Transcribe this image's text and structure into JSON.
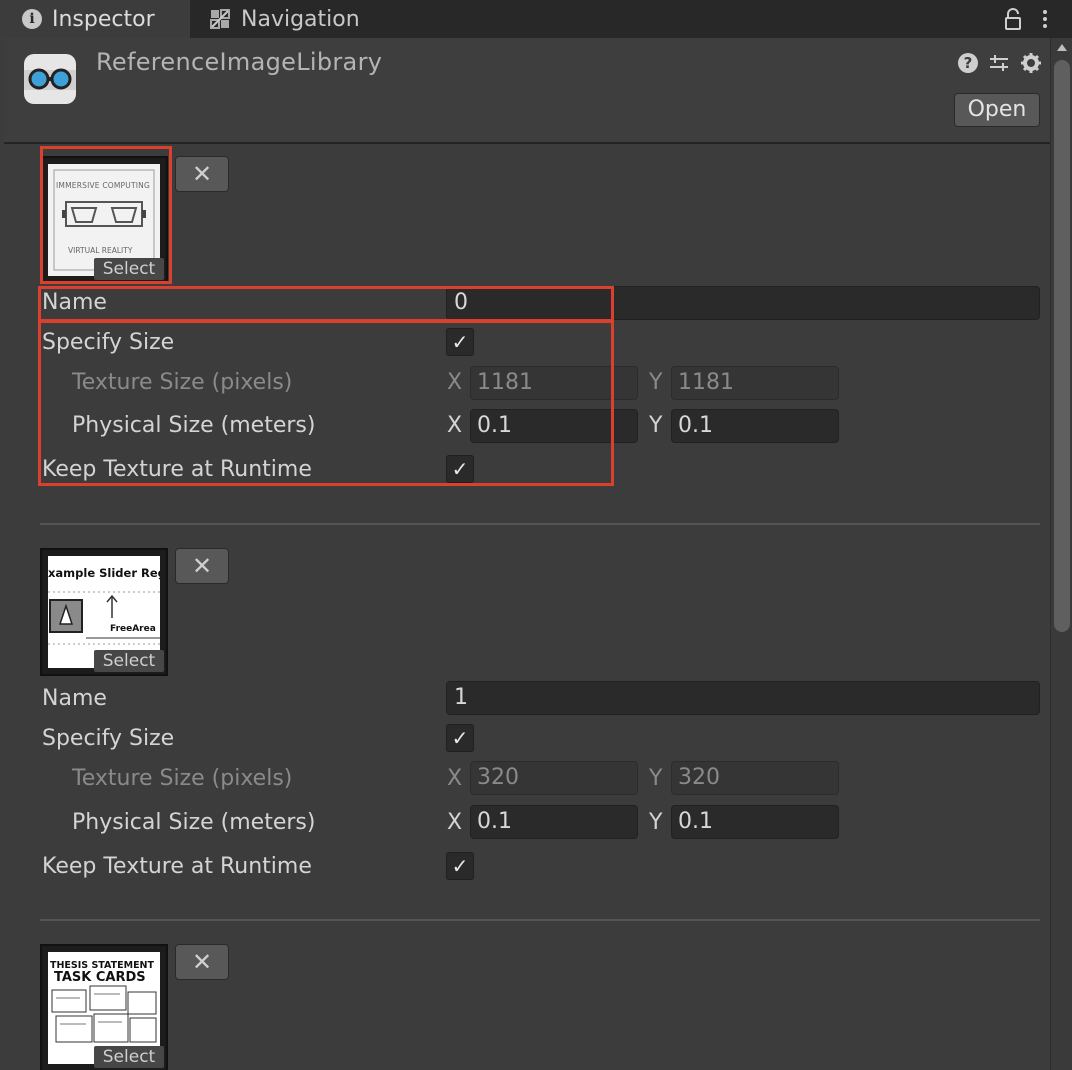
{
  "tabs": [
    {
      "label": "Inspector",
      "icon": "info-icon",
      "active": true
    },
    {
      "label": "Navigation",
      "icon": "navigation-icon",
      "active": false
    }
  ],
  "header": {
    "title": "ReferenceImageLibrary",
    "open_label": "Open",
    "icons": [
      "help-icon",
      "sliders-icon",
      "gear-icon"
    ]
  },
  "labels": {
    "select": "Select",
    "remove": "✕",
    "name": "Name",
    "specify_size": "Specify Size",
    "texture_size": "Texture Size (pixels)",
    "physical_size": "Physical Size (meters)",
    "keep_texture": "Keep Texture at Runtime",
    "x": "X",
    "y": "Y"
  },
  "images": [
    {
      "thumb_text_top": "IMMERSIVE COMPUTING",
      "thumb_text_bottom": "VIRTUAL REALITY",
      "name": "0",
      "specify_size": true,
      "texture_x": "1181",
      "texture_y": "1181",
      "physical_x": "0.1",
      "physical_y": "0.1",
      "keep_texture": true
    },
    {
      "thumb_text_top": "xample Slider Regio",
      "thumb_text_mid": "FreeArea",
      "name": "1",
      "specify_size": true,
      "texture_x": "320",
      "texture_y": "320",
      "physical_x": "0.1",
      "physical_y": "0.1",
      "keep_texture": true
    },
    {
      "thumb_text_top": "THESIS STATEMENT",
      "thumb_text_mid": "TASK CARDS"
    }
  ],
  "colors": {
    "highlight": "#d9402e",
    "panel": "#3c3c3c",
    "field": "#2a2a2a"
  }
}
